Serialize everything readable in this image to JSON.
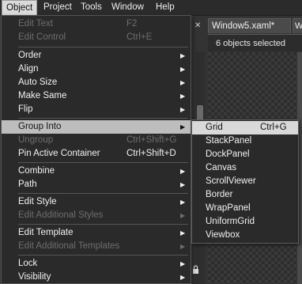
{
  "menubar": {
    "items": [
      "Object",
      "Project",
      "Tools",
      "Window",
      "Help"
    ],
    "active": "Object"
  },
  "document": {
    "tab_title": "Window5.xaml*",
    "tab_overflow": "W",
    "selection_status": "6 objects selected"
  },
  "object_menu": {
    "items": [
      {
        "label": "Edit Text",
        "shortcut": "F2",
        "disabled": true,
        "submenu": false
      },
      {
        "label": "Edit Control",
        "shortcut": "Ctrl+E",
        "disabled": true,
        "submenu": false
      },
      {
        "label": "Order",
        "shortcut": "",
        "disabled": false,
        "submenu": true
      },
      {
        "label": "Align",
        "shortcut": "",
        "disabled": false,
        "submenu": true
      },
      {
        "label": "Auto Size",
        "shortcut": "",
        "disabled": false,
        "submenu": true
      },
      {
        "label": "Make Same",
        "shortcut": "",
        "disabled": false,
        "submenu": true
      },
      {
        "label": "Flip",
        "shortcut": "",
        "disabled": false,
        "submenu": true
      },
      {
        "label": "Group Into",
        "shortcut": "",
        "disabled": false,
        "submenu": true,
        "highlighted": true
      },
      {
        "label": "Ungroup",
        "shortcut": "Ctrl+Shift+G",
        "disabled": true,
        "submenu": false
      },
      {
        "label": "Pin Active Container",
        "shortcut": "Ctrl+Shift+D",
        "disabled": false,
        "submenu": false
      },
      {
        "label": "Combine",
        "shortcut": "",
        "disabled": false,
        "submenu": true
      },
      {
        "label": "Path",
        "shortcut": "",
        "disabled": false,
        "submenu": true
      },
      {
        "label": "Edit Style",
        "shortcut": "",
        "disabled": false,
        "submenu": true
      },
      {
        "label": "Edit Additional Styles",
        "shortcut": "",
        "disabled": true,
        "submenu": true
      },
      {
        "label": "Edit Template",
        "shortcut": "",
        "disabled": false,
        "submenu": true
      },
      {
        "label": "Edit Additional Templates",
        "shortcut": "",
        "disabled": true,
        "submenu": true
      },
      {
        "label": "Lock",
        "shortcut": "",
        "disabled": false,
        "submenu": true
      },
      {
        "label": "Visibility",
        "shortcut": "",
        "disabled": false,
        "submenu": true
      }
    ]
  },
  "group_into_submenu": {
    "items": [
      {
        "label": "Grid",
        "shortcut": "Ctrl+G",
        "highlighted": true
      },
      {
        "label": "StackPanel",
        "shortcut": ""
      },
      {
        "label": "DockPanel",
        "shortcut": ""
      },
      {
        "label": "Canvas",
        "shortcut": ""
      },
      {
        "label": "ScrollViewer",
        "shortcut": ""
      },
      {
        "label": "Border",
        "shortcut": ""
      },
      {
        "label": "WrapPanel",
        "shortcut": ""
      },
      {
        "label": "UniformGrid",
        "shortcut": ""
      },
      {
        "label": "Viewbox",
        "shortcut": ""
      }
    ]
  },
  "icons": {
    "submenu_arrow": "triangle-right-icon",
    "pin": "pin-icon",
    "lock": "lock-icon"
  },
  "colors": {
    "menu_background": "#2a2a2a",
    "highlight": "#bdbdbd",
    "disabled_text": "#6e6e6e"
  }
}
